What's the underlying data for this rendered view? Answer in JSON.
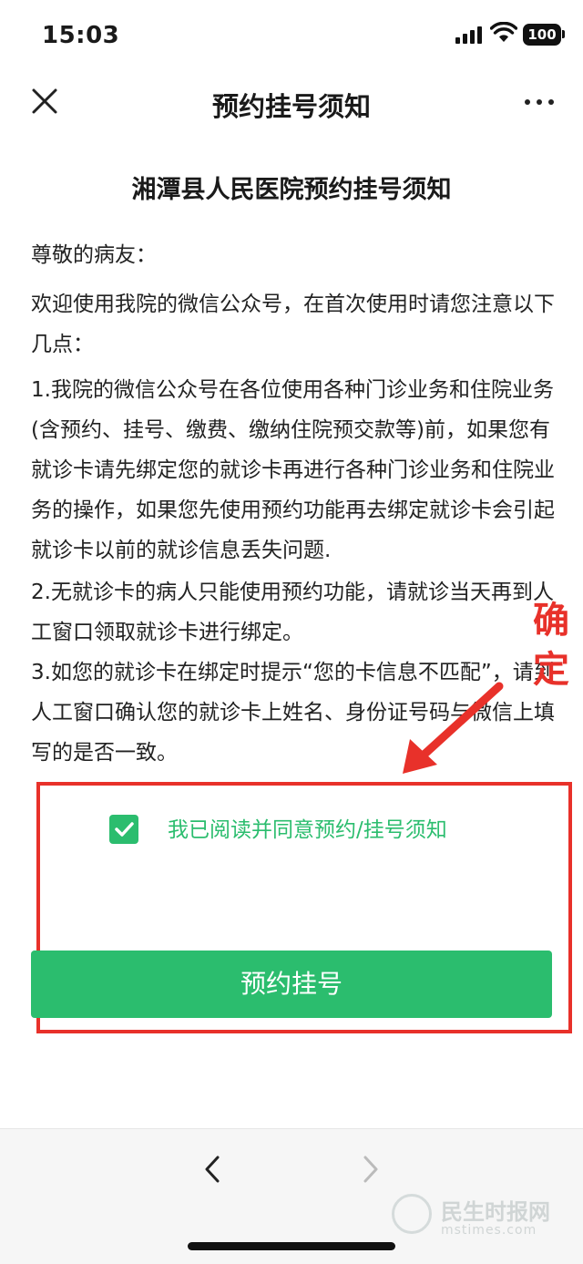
{
  "status_bar": {
    "time": "15:03",
    "battery": "100"
  },
  "nav": {
    "title": "预约挂号须知"
  },
  "notice": {
    "title": "湘潭县人民医院预约挂号须知",
    "greeting": "尊敬的病友：",
    "intro": "欢迎使用我院的微信公众号，在首次使用时请您注意以下几点：",
    "item1": "1.我院的微信公众号在各位使用各种门诊业务和住院业务(含预约、挂号、缴费、缴纳住院预交款等)前，如果您有就诊卡请先绑定您的就诊卡再进行各种门诊业务和住院业务的操作，如果您先使用预约功能再去绑定就诊卡会引起就诊卡以前的就诊信息丢失问题.",
    "item2": "2.无就诊卡的病人只能使用预约功能，请就诊当天再到人工窗口领取就诊卡进行绑定。",
    "item3": "3.如您的就诊卡在绑定时提示“您的卡信息不匹配”，请到人工窗口确认您的就诊卡上姓名、身份证号码与微信上填写的是否一致。"
  },
  "agreement": {
    "label": "我已阅读并同意预约/挂号须知",
    "checked": true
  },
  "primary_button": {
    "label": "预约挂号"
  },
  "annotation": {
    "text": "确定",
    "color": "#e8312a"
  },
  "watermark": {
    "text": "民生时报网",
    "sub": "mstimes.com"
  },
  "colors": {
    "accent": "#2bbd6e",
    "annotation": "#e8312a"
  }
}
